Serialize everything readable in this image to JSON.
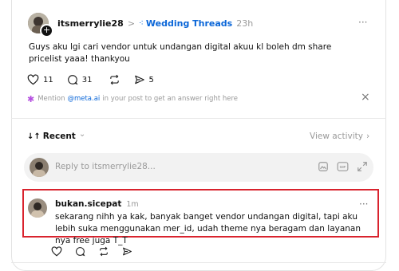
{
  "post": {
    "username": "itsmerrylie28",
    "separator": ">",
    "community": "Wedding Threads",
    "time": "23h",
    "more": "···",
    "text": "Guys aku lgi cari vendor untuk undangan digital akuu kl boleh dm share pricelist yaaa! thankyou",
    "likes": "11",
    "comments": "31",
    "shares": "5"
  },
  "meta_tip": {
    "prefix": "Mention",
    "handle": "@meta.ai",
    "suffix": "in your post to get an answer right here",
    "close": "×"
  },
  "sort": {
    "label": "Recent",
    "arrows": "↓↑",
    "chevron": "⌄",
    "view_activity": "View activity",
    "view_chevron": "›"
  },
  "reply": {
    "placeholder": "Reply to itsmerrylie28..."
  },
  "comment": {
    "username": "bukan.sicepat",
    "time": "1m",
    "more": "···",
    "text": "sekarang nihh ya kak, banyak banget vendor undangan digital, tapi aku lebih suka menggunakan mer_id, udah theme nya beragam dan layanan nya free juga T_T"
  },
  "colors": {
    "accent_blue": "#0a66d8",
    "highlight_red": "#d9232e",
    "muted": "#999999"
  },
  "icons": [
    "heart-icon",
    "comment-icon",
    "repost-icon",
    "share-icon",
    "sparkle-icon",
    "close-icon",
    "image-icon",
    "gif-icon",
    "expand-icon",
    "threads-community-icon"
  ]
}
